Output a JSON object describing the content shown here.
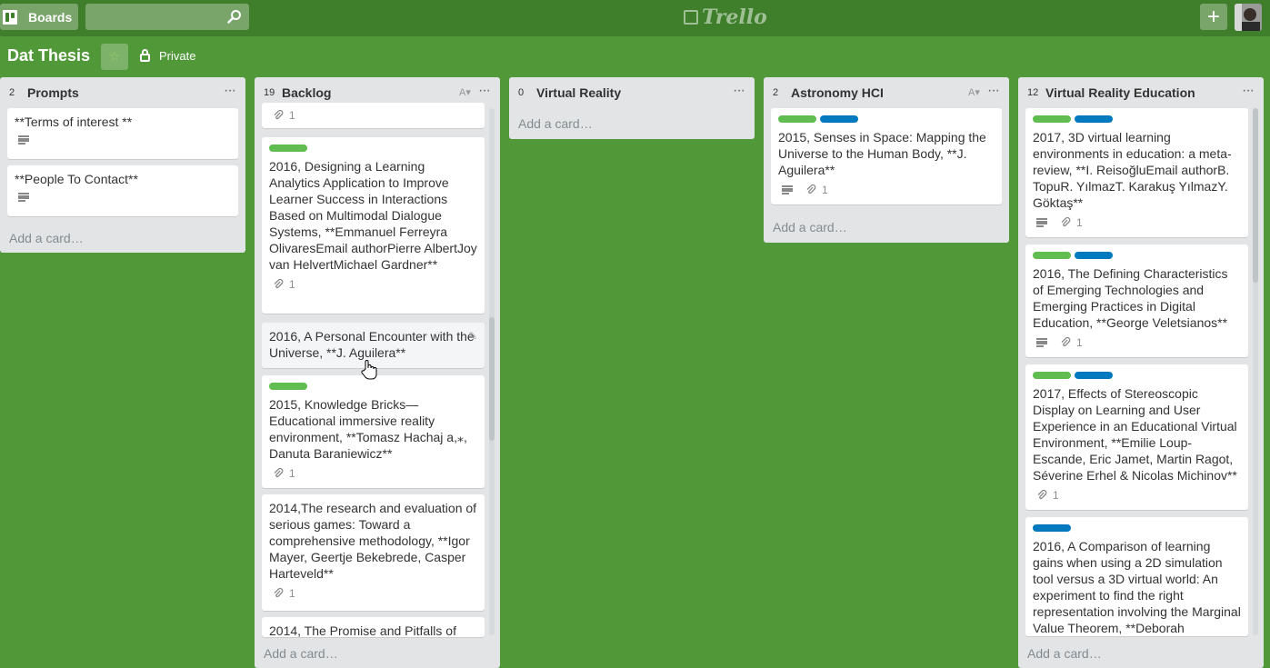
{
  "header": {
    "boards_label": "Boards",
    "search_placeholder": "",
    "logo_text": "Trello",
    "add_label": "+"
  },
  "board": {
    "title": "Dat Thesis",
    "visibility": "Private"
  },
  "lists": {
    "prompts": {
      "count": "2",
      "title": "Prompts",
      "add_card": "Add a card…",
      "cards": [
        {
          "text": "**Terms of interest **"
        },
        {
          "text": "**People To Contact**"
        }
      ]
    },
    "backlog": {
      "count": "19",
      "title": "Backlog",
      "sort": "A▾",
      "add_card": "Add a card…",
      "cards": [
        {
          "attachments": "1"
        },
        {
          "text": "2016, Designing a Learning Analytics Application to Improve Learner Success in Interactions Based on Multimodal Dialogue Systems, **Emmanuel Ferreyra OlivaresEmail authorPierre AlbertJoy van HelvertMichael Gardner**",
          "attachments": "1"
        },
        {
          "text": "2016, A Personal Encounter with the Universe, **J. Aguilera**"
        },
        {
          "text": "2015, Knowledge Bricks—Educational immersive reality environment, **Tomasz Hachaj a,⁎, Danuta Baraniewicz**",
          "attachments": "1"
        },
        {
          "text": "2014,The research and evaluation of serious games: Toward a comprehensive methodology, **Igor Mayer, Geertje Bekebrede, Casper Harteveld**",
          "attachments": "1"
        },
        {
          "text": "2014, The Promise and Pitfalls of"
        }
      ]
    },
    "vr": {
      "count": "0",
      "title": "Virtual Reality",
      "add_card": "Add a card…"
    },
    "astro": {
      "count": "2",
      "title": "Astronomy HCI",
      "sort": "A▾",
      "add_card": "Add a card…",
      "cards": [
        {
          "text": "2015, Senses in Space: Mapping the Universe to the Human Body, **J. Aguilera**",
          "attachments": "1"
        }
      ]
    },
    "vre": {
      "count": "12",
      "title": "Virtual Reality Education",
      "add_card": "Add a card…",
      "cards": [
        {
          "text": "2017, 3D virtual learning environments in education: a meta-review, **I. ReisoğluEmail authorB. TopuR. YılmazT. Karakuş YılmazY. Göktaş**",
          "attachments": "1"
        },
        {
          "text": "2016, The Defining Characteristics of Emerging Technologies and Emerging Practices in Digital Education, **George Veletsianos**",
          "attachments": "1"
        },
        {
          "text": "2017, Effects of Stereoscopic Display on Learning and User Experience in an Educational Virtual Environment, **Emilie Loup-Escande, Eric Jamet, Martin Ragot, Séverine Erhel & Nicolas Michinov**",
          "attachments": "1"
        },
        {
          "text": "2016, A Comparison of learning gains when using a 2D simulation tool versus a 3D virtual world: An experiment to find the right representation involving the Marginal Value Theorem, **Deborah"
        }
      ]
    }
  },
  "colors": {
    "board_bg": "#519839",
    "header_bg": "#3f7f2b",
    "label_green": "#61bd4f",
    "label_blue": "#0079bf"
  }
}
